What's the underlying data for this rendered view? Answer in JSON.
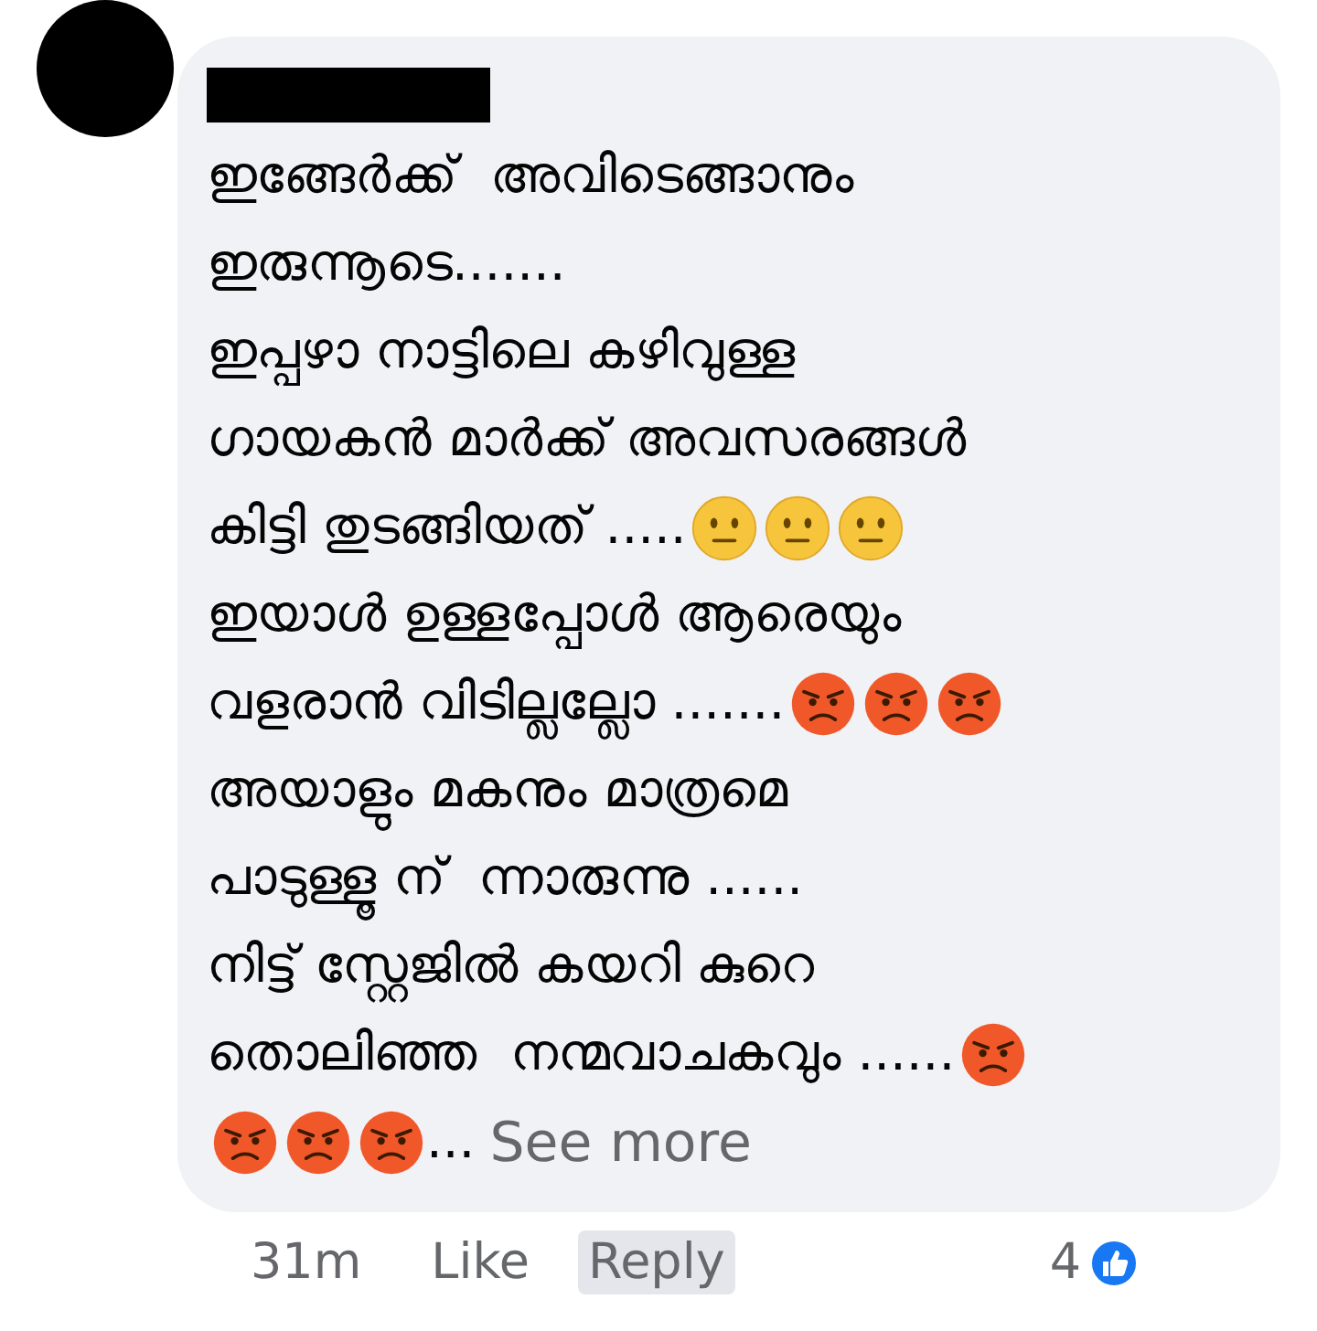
{
  "comment": {
    "author_redacted": true,
    "lines": [
      [
        {
          "kind": "text",
          "text": "ഇങ്ങേർക്ക്  അവിടെങ്ങാനും"
        }
      ],
      [
        {
          "kind": "text",
          "text": "ഇരുന്നൂടെ......."
        }
      ],
      [
        {
          "kind": "text",
          "text": "ഇപ്പഴാ നാട്ടിലെ കഴിവുള്ള"
        }
      ],
      [
        {
          "kind": "text",
          "text": "ഗായകൻ മാർക്ക് അവസരങ്ങൾ"
        }
      ],
      [
        {
          "kind": "text",
          "text": "കിട്ടി തുടങ്ങിയത് ....."
        },
        {
          "kind": "neutral"
        },
        {
          "kind": "neutral"
        },
        {
          "kind": "neutral"
        }
      ],
      [
        {
          "kind": "text",
          "text": "ഇയാൾ ഉള്ളപ്പോൾ ആരെയും"
        }
      ],
      [
        {
          "kind": "text",
          "text": "വളരാൻ വിടില്ലല്ലോ ......."
        },
        {
          "kind": "angry"
        },
        {
          "kind": "angry"
        },
        {
          "kind": "angry"
        }
      ],
      [
        {
          "kind": "text",
          "text": "അയാളും മകനും മാത്രമെ"
        }
      ],
      [
        {
          "kind": "text",
          "text": "പാടുള്ളൂ ന്  ന്നാരുന്നു ......"
        }
      ],
      [
        {
          "kind": "text",
          "text": "നിട്ട് സ്റ്റേജിൽ കയറി കുറെ"
        }
      ],
      [
        {
          "kind": "text",
          "text": "തൊലിഞ്ഞ  നന്മവാചകവും ......"
        },
        {
          "kind": "angry"
        }
      ],
      [
        {
          "kind": "angry"
        },
        {
          "kind": "angry"
        },
        {
          "kind": "angry"
        },
        {
          "kind": "text",
          "text": "..."
        },
        {
          "kind": "link",
          "text": "See more"
        }
      ]
    ]
  },
  "actions": {
    "time": "31m",
    "buttons": [
      {
        "label": "Like",
        "highlighted": false
      },
      {
        "label": "Reply",
        "highlighted": true
      }
    ],
    "reaction_count": "4"
  }
}
